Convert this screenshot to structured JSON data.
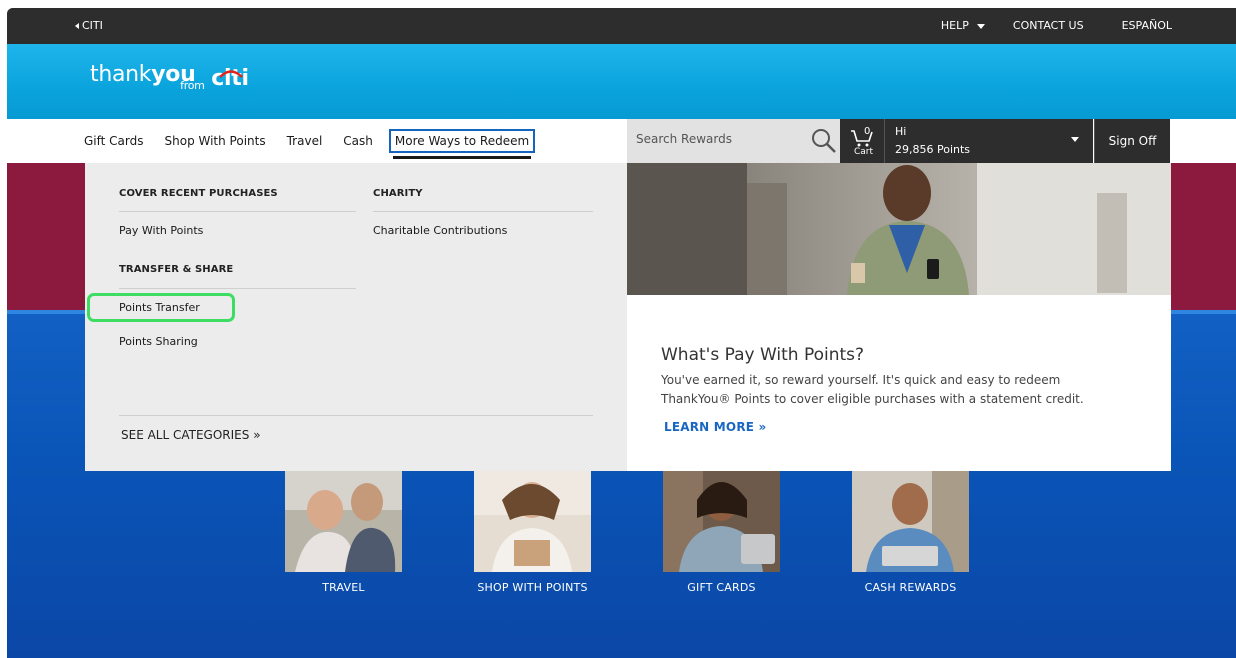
{
  "utility": {
    "back_label": "CITI",
    "help_label": "HELP",
    "contact_label": "CONTACT US",
    "language_label": "ESPAÑOL"
  },
  "brand": {
    "logo_thank": "thank",
    "logo_you": "you",
    "logo_from": "from",
    "logo_citi": "citi"
  },
  "nav": {
    "items": [
      {
        "label": "Gift Cards"
      },
      {
        "label": "Shop With Points"
      },
      {
        "label": "Travel"
      },
      {
        "label": "Cash"
      },
      {
        "label": "More Ways to Redeem"
      }
    ],
    "search_placeholder": "Search Rewards",
    "cart_count": "0",
    "cart_label": "Cart",
    "greeting": "Hi",
    "points": "29,856 Points",
    "signoff_label": "Sign Off"
  },
  "mega_menu": {
    "col1_heading": "COVER RECENT PURCHASES",
    "col1_link": "Pay With Points",
    "col1_heading2": "TRANSFER & SHARE",
    "col1_link2": "Points Transfer",
    "col1_link3": "Points Sharing",
    "col2_heading": "CHARITY",
    "col2_link": "Charitable Contributions",
    "see_all": "SEE ALL CATEGORIES »",
    "promo_title": "What's Pay With Points?",
    "promo_body": "You've earned it, so reward yourself. It's quick and easy to redeem ThankYou® Points to cover eligible purchases with a statement credit.",
    "promo_link": "LEARN MORE »"
  },
  "categories": [
    {
      "label": "TRAVEL"
    },
    {
      "label": "SHOP WITH POINTS"
    },
    {
      "label": "GIFT CARDS"
    },
    {
      "label": "CASH REWARDS"
    }
  ],
  "colors": {
    "utility_bar": "#2d2d2d",
    "brand_band": "#0ba3dc",
    "hero_maroon": "#8c1a3e",
    "hero_blue": "#0b4fae",
    "highlight": "#3ddc63",
    "active_outline": "#1565c0"
  }
}
